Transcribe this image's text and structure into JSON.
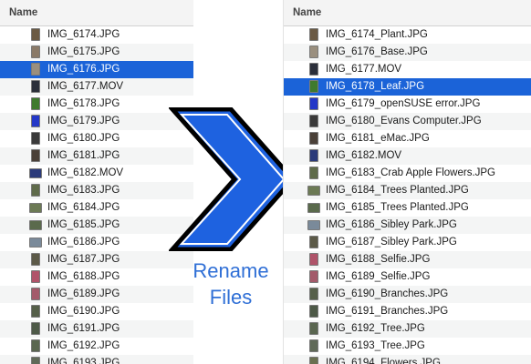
{
  "left_pane": {
    "column_header": "Name",
    "files": [
      {
        "name": "IMG_6174.JPG",
        "color": "#6b5a44",
        "kind": "tall"
      },
      {
        "name": "IMG_6175.JPG",
        "color": "#8a7a68",
        "kind": "tall"
      },
      {
        "name": "IMG_6176.JPG",
        "color": "#9a8f7e",
        "kind": "tall",
        "selected": true
      },
      {
        "name": "IMG_6177.MOV",
        "color": "#2b2f3a",
        "kind": "tall"
      },
      {
        "name": "IMG_6178.JPG",
        "color": "#3f7a2e",
        "kind": "tall"
      },
      {
        "name": "IMG_6179.JPG",
        "color": "#2438c8",
        "kind": "tall"
      },
      {
        "name": "IMG_6180.JPG",
        "color": "#3a3a3a",
        "kind": "tall"
      },
      {
        "name": "IMG_6181.JPG",
        "color": "#4a4038",
        "kind": "tall"
      },
      {
        "name": "IMG_6182.MOV",
        "color": "#2a3a7a",
        "kind": "wide"
      },
      {
        "name": "IMG_6183.JPG",
        "color": "#5f6b4a",
        "kind": "tall"
      },
      {
        "name": "IMG_6184.JPG",
        "color": "#6c7a55",
        "kind": "wide"
      },
      {
        "name": "IMG_6185.JPG",
        "color": "#5a6a4c",
        "kind": "wide"
      },
      {
        "name": "IMG_6186.JPG",
        "color": "#7a8a9a",
        "kind": "wide"
      },
      {
        "name": "IMG_6187.JPG",
        "color": "#5c5a48",
        "kind": "tall"
      },
      {
        "name": "IMG_6188.JPG",
        "color": "#b0546a",
        "kind": "tall"
      },
      {
        "name": "IMG_6189.JPG",
        "color": "#a35a6a",
        "kind": "tall"
      },
      {
        "name": "IMG_6190.JPG",
        "color": "#56604a",
        "kind": "tall"
      },
      {
        "name": "IMG_6191.JPG",
        "color": "#4e5a48",
        "kind": "tall"
      },
      {
        "name": "IMG_6192.JPG",
        "color": "#5a6650",
        "kind": "tall"
      },
      {
        "name": "IMG_6193.JPG",
        "color": "#606a58",
        "kind": "tall"
      }
    ]
  },
  "right_pane": {
    "column_header": "Name",
    "files": [
      {
        "name": "IMG_6174_Plant.JPG",
        "color": "#6b5a44",
        "kind": "tall"
      },
      {
        "name": "IMG_6176_Base.JPG",
        "color": "#9a8f7e",
        "kind": "tall"
      },
      {
        "name": "IMG_6177.MOV",
        "color": "#2b2f3a",
        "kind": "tall"
      },
      {
        "name": "IMG_6178_Leaf.JPG",
        "color": "#3f7a2e",
        "kind": "tall",
        "selected": true
      },
      {
        "name": "IMG_6179_openSUSE error.JPG",
        "color": "#2438c8",
        "kind": "tall"
      },
      {
        "name": "IMG_6180_Evans Computer.JPG",
        "color": "#3a3a3a",
        "kind": "tall"
      },
      {
        "name": "IMG_6181_eMac.JPG",
        "color": "#4a4038",
        "kind": "tall"
      },
      {
        "name": "IMG_6182.MOV",
        "color": "#2a3a7a",
        "kind": "tall"
      },
      {
        "name": "IMG_6183_Crab Apple Flowers.JPG",
        "color": "#5f6b4a",
        "kind": "tall"
      },
      {
        "name": "IMG_6184_Trees Planted.JPG",
        "color": "#6c7a55",
        "kind": "wide"
      },
      {
        "name": "IMG_6185_Trees Planted.JPG",
        "color": "#5a6a4c",
        "kind": "wide"
      },
      {
        "name": "IMG_6186_Sibley Park.JPG",
        "color": "#7a8a9a",
        "kind": "wide"
      },
      {
        "name": "IMG_6187_Sibley Park.JPG",
        "color": "#5c5a48",
        "kind": "tall"
      },
      {
        "name": "IMG_6188_Selfie.JPG",
        "color": "#b0546a",
        "kind": "tall"
      },
      {
        "name": "IMG_6189_Selfie.JPG",
        "color": "#a35a6a",
        "kind": "tall"
      },
      {
        "name": "IMG_6190_Branches.JPG",
        "color": "#56604a",
        "kind": "tall"
      },
      {
        "name": "IMG_6191_Branches.JPG",
        "color": "#4e5a48",
        "kind": "tall"
      },
      {
        "name": "IMG_6192_Tree.JPG",
        "color": "#5a6650",
        "kind": "tall"
      },
      {
        "name": "IMG_6193_Tree.JPG",
        "color": "#606a58",
        "kind": "tall"
      },
      {
        "name": "IMG_6194_Flowers.JPG",
        "color": "#6a7050",
        "kind": "tall"
      }
    ]
  },
  "graphic": {
    "icon": "chevron-right-icon",
    "arrow_fill": "#1e62e0",
    "arrow_stroke": "#000000",
    "caption_line1": "Rename",
    "caption_line2": "Files",
    "caption_color": "#2f6fd6"
  }
}
